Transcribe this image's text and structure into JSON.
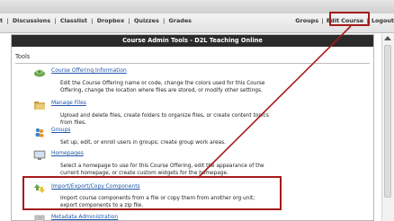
{
  "nav": {
    "left_items": [
      "t",
      "Discussions",
      "Classlist",
      "Dropbox",
      "Quizzes",
      "Grades"
    ],
    "right_items": [
      "Groups",
      "Edit Course",
      "Logout"
    ]
  },
  "panel": {
    "title": "Course Admin Tools - D2L Teaching Online",
    "section_title": "Tools"
  },
  "tools": [
    {
      "name": "Course Offering Information",
      "icon": "gear-icon",
      "description_lines": [
        "Edit the Course Offering name or code, change the colors used for this Course",
        "Offering, change the location where files are stored, or modify other settings."
      ]
    },
    {
      "name": "Manage Files",
      "icon": "folder-icon",
      "description_lines": [
        "Upload and delete files, create folders to organize files, or create content topics",
        "from files."
      ]
    },
    {
      "name": "Groups",
      "icon": "people-icon",
      "description_lines": [
        "Set up, edit, or enroll users in groups; create group work areas."
      ]
    },
    {
      "name": "Homepages",
      "icon": "monitor-icon",
      "description_lines": [
        "Select a homepage to use for this Course Offering, edit the appearance of the",
        "current homepage, or create custom widgets for the homepage."
      ]
    },
    {
      "name": "Import/Export/Copy Components",
      "icon": "import-export-icon",
      "description_lines": [
        "Import course components from a file or copy them from another org unit;",
        "export components to a zip file."
      ]
    },
    {
      "name": "Metadata Administration",
      "icon": "metadata-icon",
      "description_lines": []
    }
  ],
  "colors": {
    "highlight": "#a41b1b",
    "link": "#1f56a8",
    "header_bg": "#2b2b2b"
  }
}
